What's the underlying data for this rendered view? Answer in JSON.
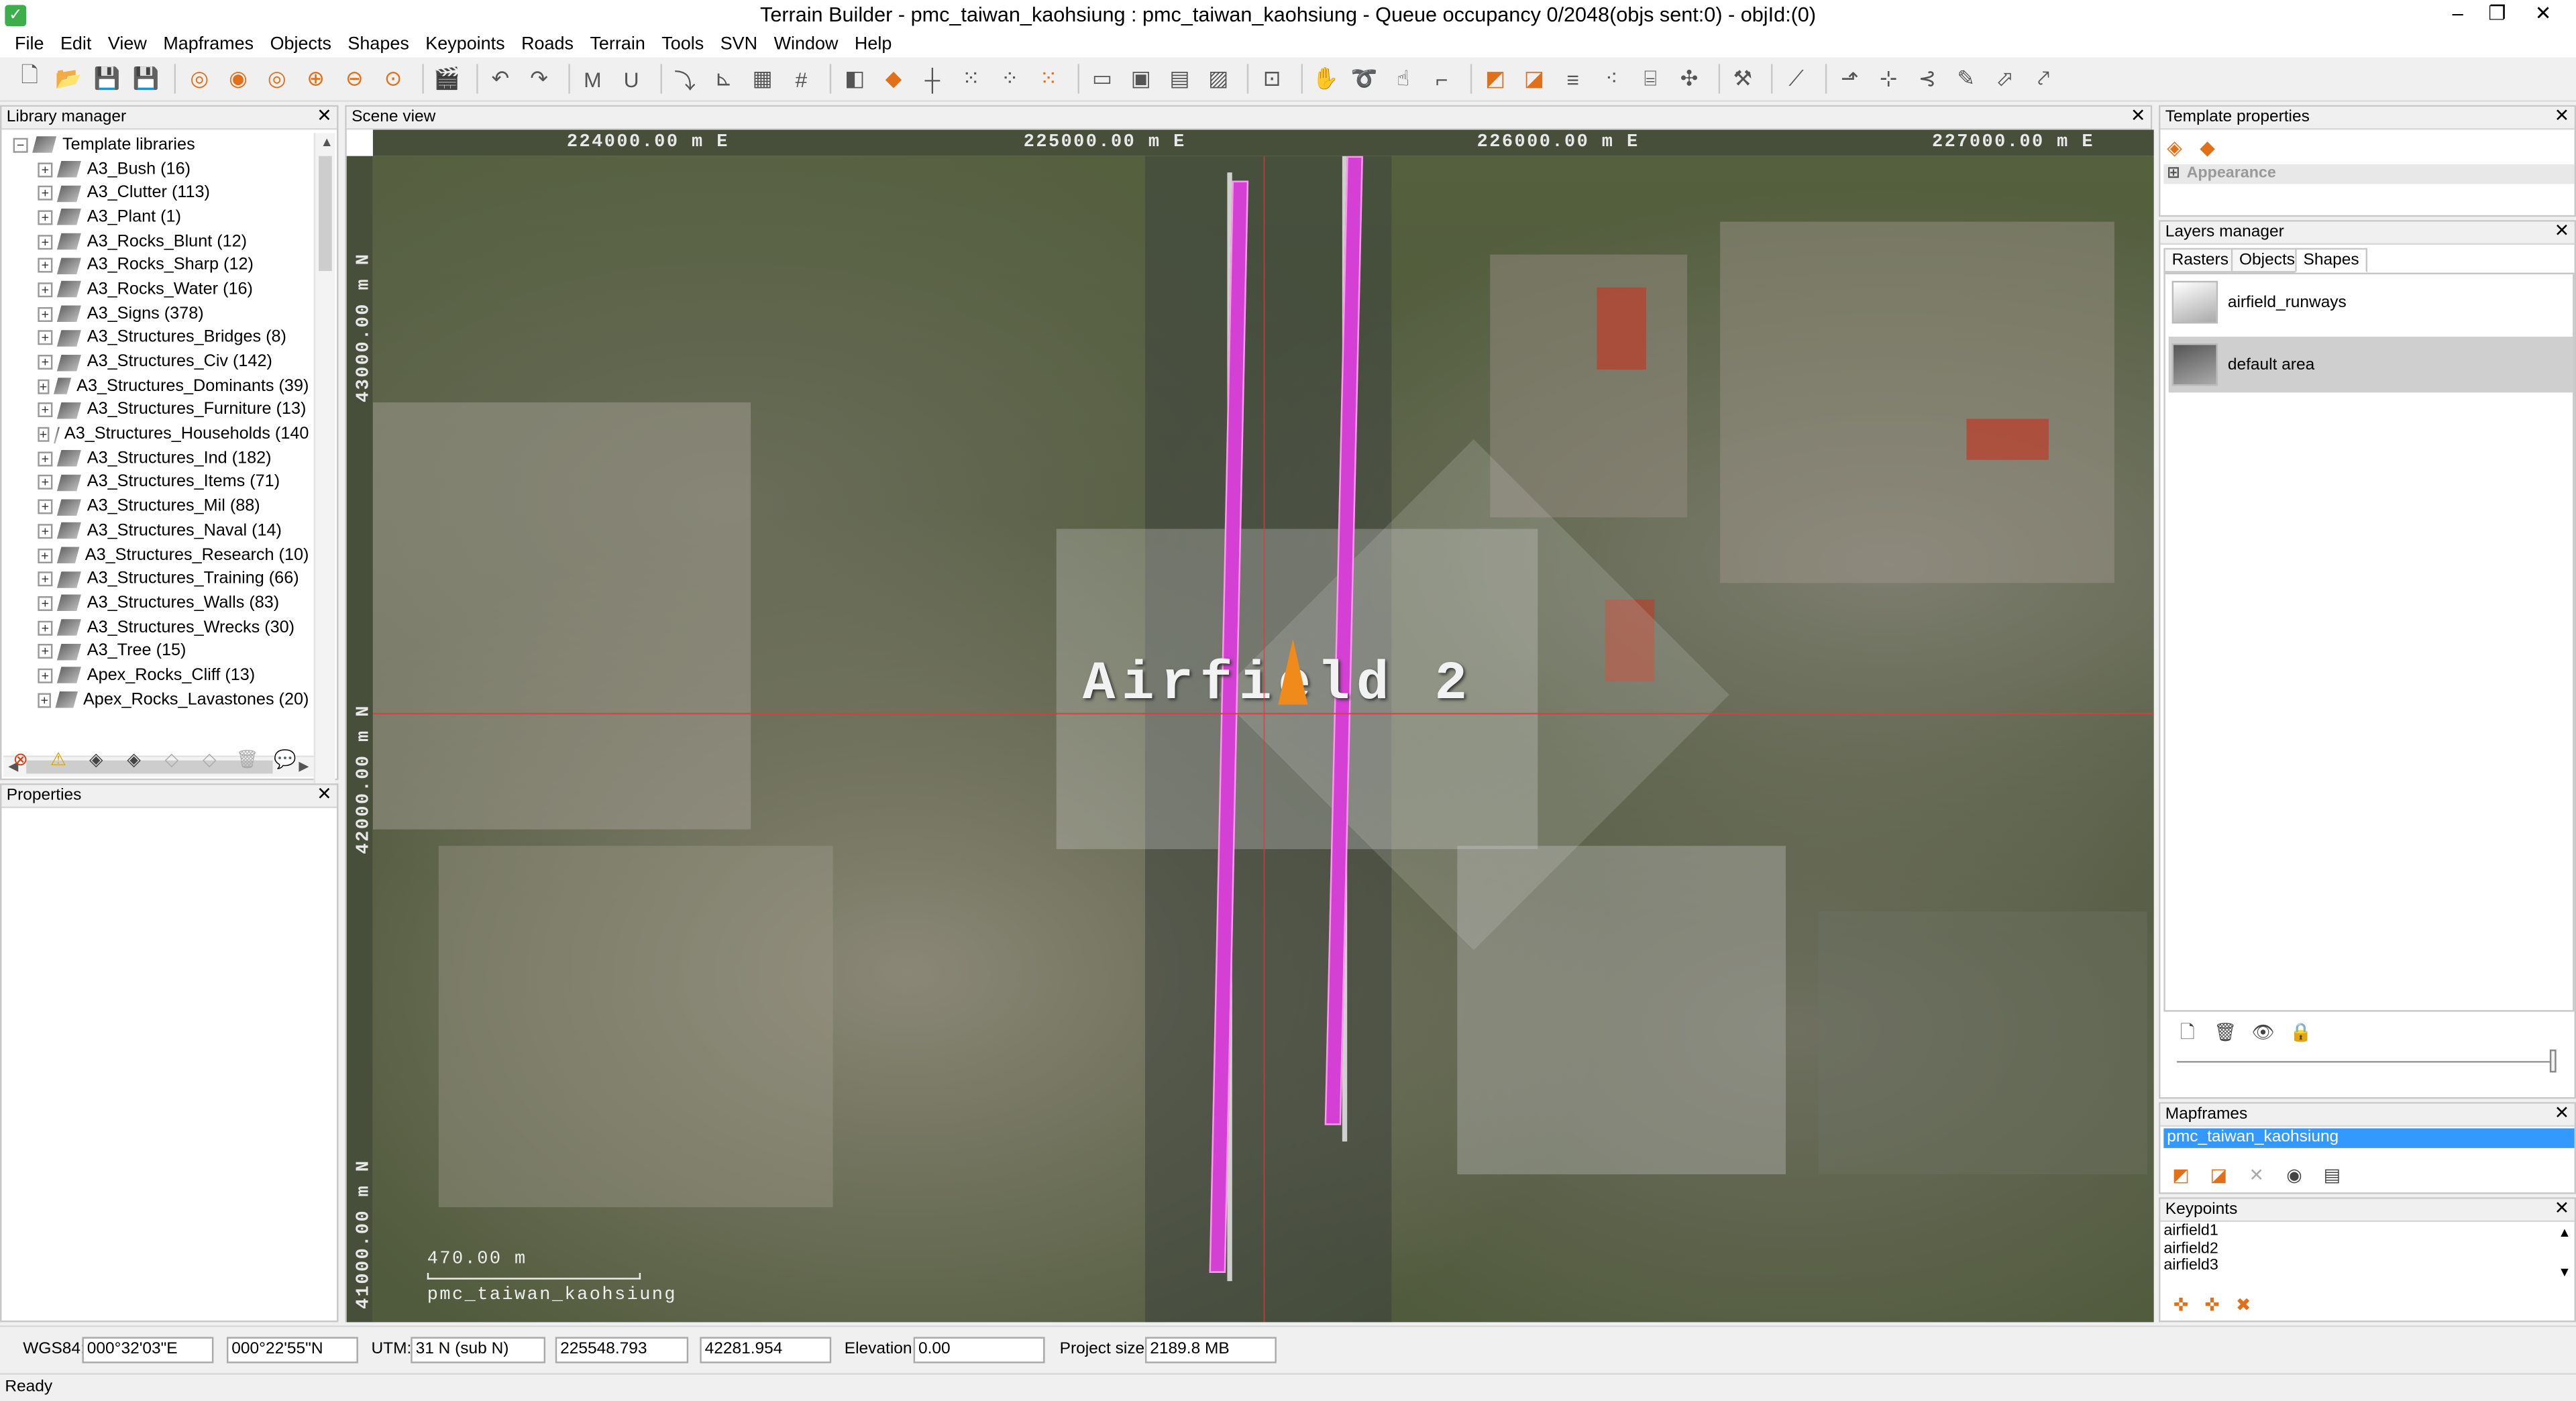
{
  "window": {
    "title": "Terrain Builder - pmc_taiwan_kaohsiung : pmc_taiwan_kaohsiung - Queue occupancy 0/2048(objs sent:0) - objId:(0)",
    "minimize": "–",
    "restore": "❐",
    "close": "✕"
  },
  "menu": [
    "File",
    "Edit",
    "View",
    "Mapframes",
    "Objects",
    "Shapes",
    "Keypoints",
    "Roads",
    "Terrain",
    "Tools",
    "SVN",
    "Window",
    "Help"
  ],
  "library": {
    "title": "Library manager",
    "root": "Template libraries",
    "items": [
      "A3_Bush (16)",
      "A3_Clutter (113)",
      "A3_Plant (1)",
      "A3_Rocks_Blunt (12)",
      "A3_Rocks_Sharp (12)",
      "A3_Rocks_Water (16)",
      "A3_Signs (378)",
      "A3_Structures_Bridges (8)",
      "A3_Structures_Civ (142)",
      "A3_Structures_Dominants (39)",
      "A3_Structures_Furniture (13)",
      "A3_Structures_Households (140",
      "A3_Structures_Ind (182)",
      "A3_Structures_Items (71)",
      "A3_Structures_Mil (88)",
      "A3_Structures_Naval (14)",
      "A3_Structures_Research (10)",
      "A3_Structures_Training (66)",
      "A3_Structures_Walls (83)",
      "A3_Structures_Wrecks (30)",
      "A3_Tree (15)",
      "Apex_Rocks_Cliff (13)",
      "Apex_Rocks_Lavastones (20)"
    ]
  },
  "properties": {
    "title": "Properties"
  },
  "scene": {
    "title": "Scene view",
    "x_coords": [
      "224000.00 m E",
      "225000.00 m E",
      "226000.00 m E",
      "227000.00 m E"
    ],
    "y_coords": [
      "43000.00 m N",
      "42000.00 m N",
      "41000.00 m N"
    ],
    "label": "Airfield 2",
    "scale": "470.00 m",
    "map_name": "pmc_taiwan_kaohsiung",
    "colors": {
      "runway": "#d43fd4",
      "cursor": "#f08a1a",
      "crosshair": "#dc3c3c"
    }
  },
  "template_properties": {
    "title": "Template properties",
    "appearance": "Appearance"
  },
  "layers": {
    "title": "Layers manager",
    "tabs": [
      "Rasters",
      "Objects",
      "Shapes"
    ],
    "active_tab": "Shapes",
    "items": [
      "airfield_runways",
      "default area"
    ]
  },
  "mapframes": {
    "title": "Mapframes",
    "items": [
      "pmc_taiwan_kaohsiung"
    ]
  },
  "keypoints": {
    "title": "Keypoints",
    "items": [
      "airfield1",
      "airfield2",
      "airfield3"
    ]
  },
  "coords": {
    "wgs_label": "WGS84:",
    "lon": "000°32'03\"E",
    "lat": "000°22'55\"N",
    "utm_label": "UTM:",
    "zone": "31 N  (sub N)",
    "easting": "225548.793",
    "northing": "42281.954",
    "elev_label": "Elevation:",
    "elevation": "0.00",
    "size_label": "Project size:",
    "size": "2189.8 MB"
  },
  "status": "Ready"
}
